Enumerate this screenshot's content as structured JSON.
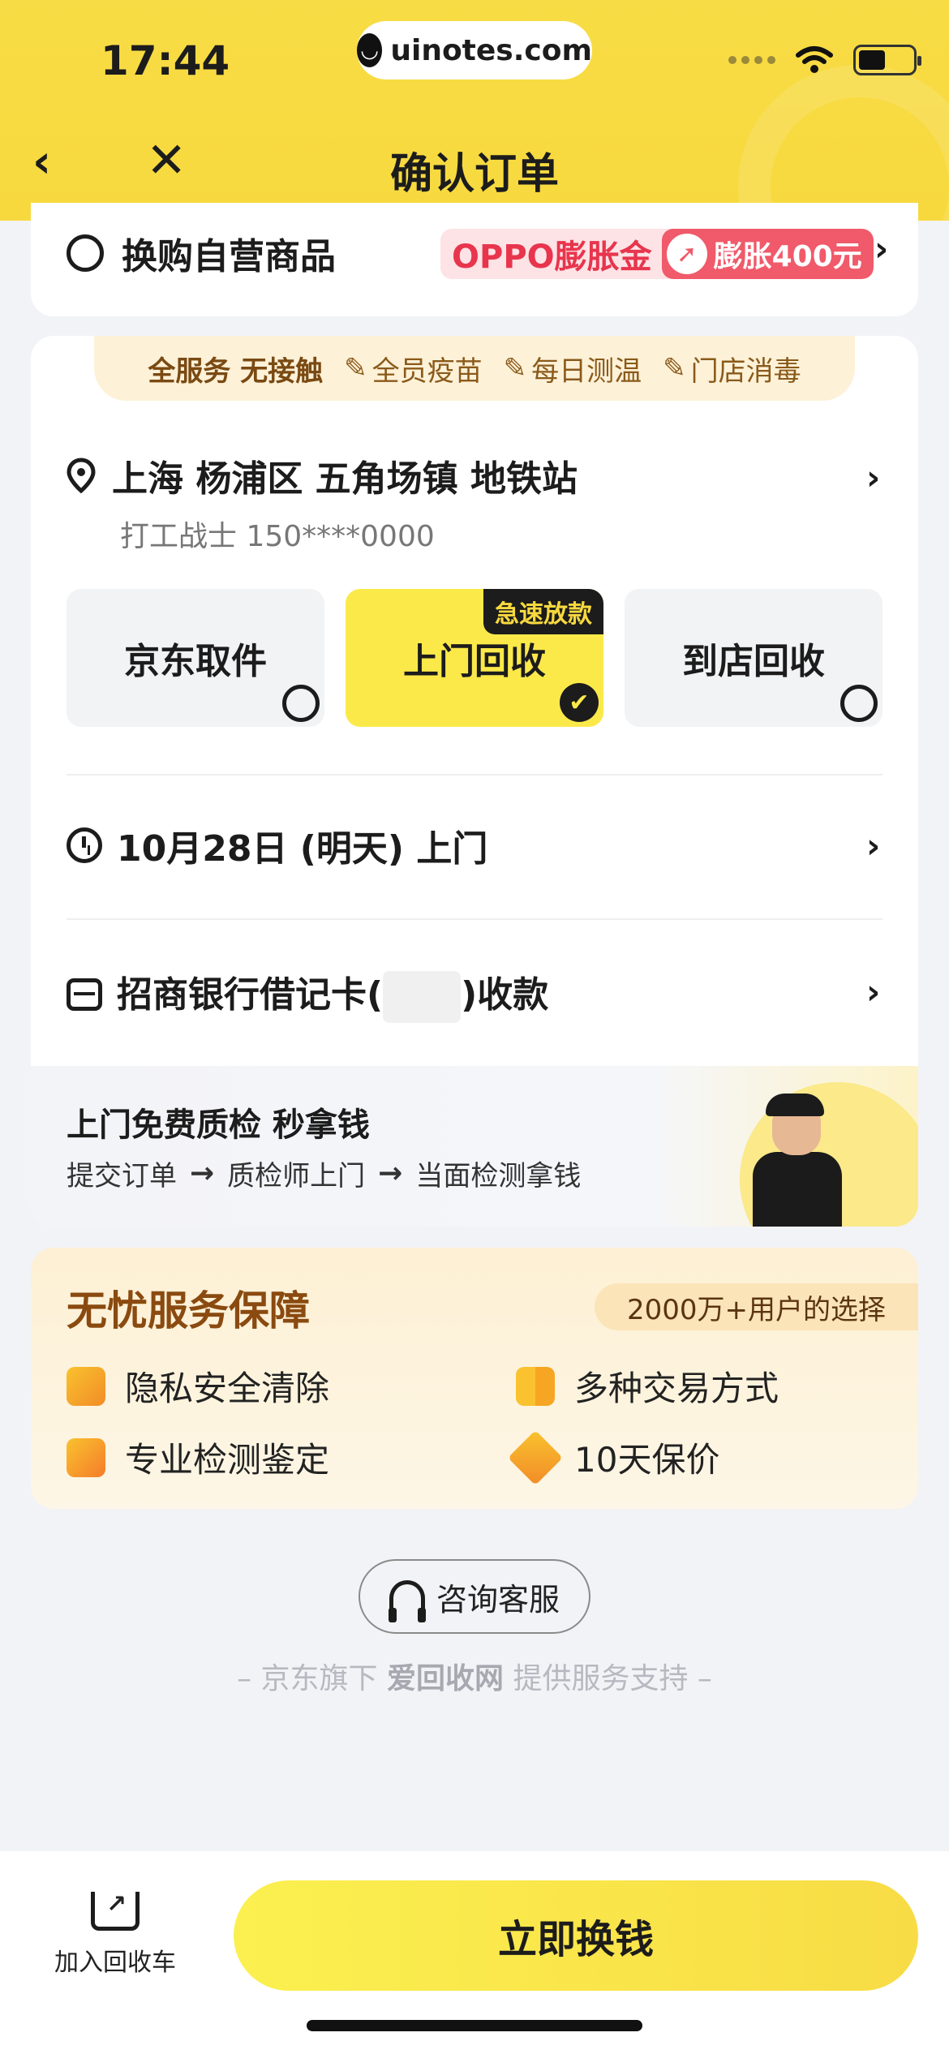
{
  "status_bar": {
    "time": "17:44",
    "url": "uinotes.com"
  },
  "nav": {
    "back_icon": "‹",
    "close_icon": "✕",
    "title": "确认订单"
  },
  "swap": {
    "label": "换购自营商品",
    "brand_text": "OPPO膨胀金",
    "boost_text": "膨胀400元",
    "chevron": "›"
  },
  "service_strip": {
    "lead": "全服务 无接触",
    "items": [
      "全员疫苗",
      "每日测温",
      "门店消毒"
    ]
  },
  "address": {
    "line1": "上海 杨浦区 五角场镇 地铁站",
    "line2": "打工战士 150****0000"
  },
  "methods": [
    {
      "label": "京东取件",
      "selected": false
    },
    {
      "label": "上门回收",
      "selected": true,
      "badge": "急速放款"
    },
    {
      "label": "到店回收",
      "selected": false
    }
  ],
  "schedule": {
    "text": "10月28日 (明天) 上门"
  },
  "payment": {
    "prefix": "招商银行借记卡(",
    "suffix": ")收款"
  },
  "promo": {
    "title": "上门免费质检 秒拿钱",
    "steps": [
      "提交订单",
      "质检师上门",
      "当面检测拿钱"
    ],
    "arrow": "→"
  },
  "guarantee": {
    "title": "无忧服务保障",
    "pill": "2000万+用户的选择",
    "items": [
      "隐私安全清除",
      "多种交易方式",
      "专业检测鉴定",
      "10天保价"
    ]
  },
  "consult": {
    "label": "咨询客服"
  },
  "support": {
    "prefix": "– 京东旗下 ",
    "brand": "爱回收网",
    "suffix": " 提供服务支持 –"
  },
  "bottom": {
    "cart_label": "加入回收车",
    "cta_label": "立即换钱"
  },
  "colors": {
    "brand_yellow": "#f8dc45",
    "oppo_red": "#e8354d",
    "guarantee_brown": "#8a4a10"
  }
}
